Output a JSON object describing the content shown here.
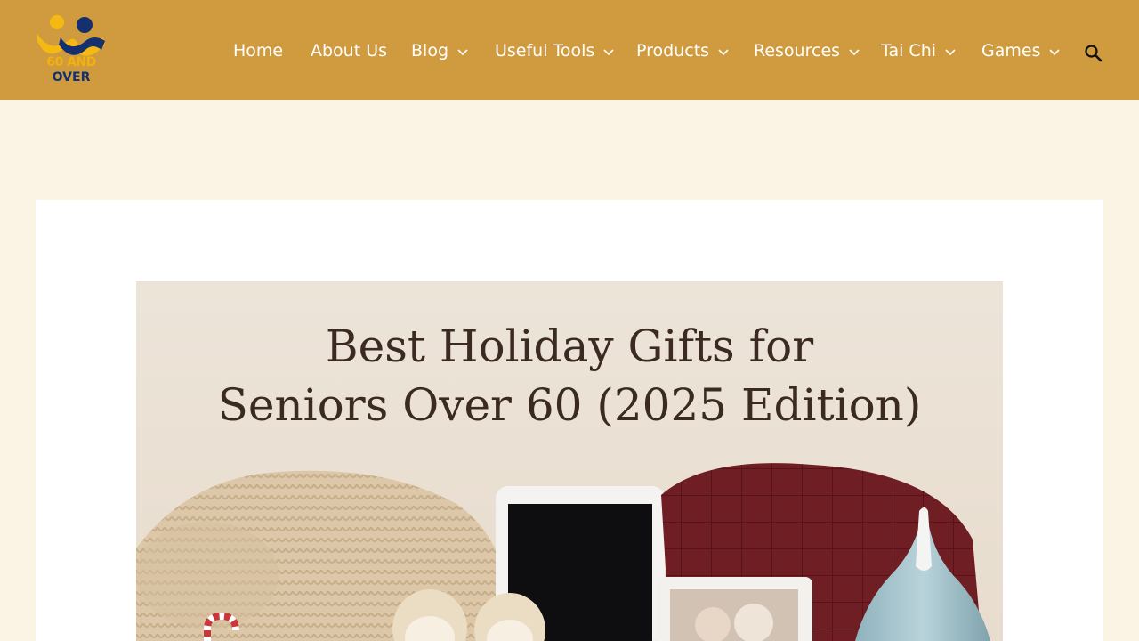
{
  "site": {
    "logo_line1": "60 AND",
    "logo_line2": "OVER",
    "logo_alt": "60 and Over logo"
  },
  "nav": {
    "items": [
      {
        "label": "Home",
        "has_dropdown": false
      },
      {
        "label": "About Us",
        "has_dropdown": false
      },
      {
        "label": "Blog",
        "has_dropdown": true
      },
      {
        "label": "Useful Tools",
        "has_dropdown": true
      },
      {
        "label": "Products",
        "has_dropdown": true
      },
      {
        "label": "Resources",
        "has_dropdown": true
      },
      {
        "label": "Tai Chi",
        "has_dropdown": true
      },
      {
        "label": "Games",
        "has_dropdown": true
      }
    ],
    "search_icon": "search-icon",
    "dropdown_icon": "chevron-down-icon"
  },
  "article": {
    "hero_title_line1": "Best Holiday Gifts for",
    "hero_title_line2": "Seniors Over 60 (2025 Edition)"
  },
  "colors": {
    "header_bg": "#d09b3f",
    "page_bg": "#fbf4e4",
    "nav_text": "#ffffff",
    "logo_yellow": "#f2b10f",
    "logo_navy": "#14306e"
  }
}
